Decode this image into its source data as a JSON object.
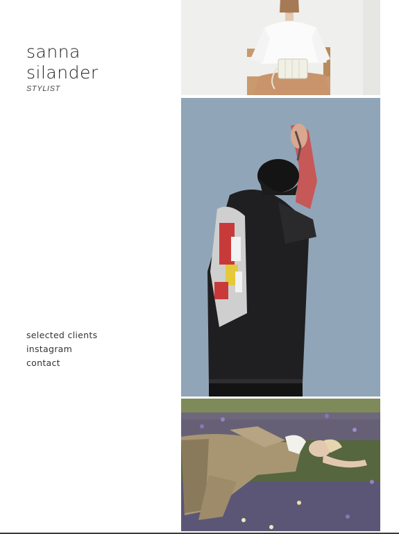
{
  "brand": {
    "first_name": "sanna",
    "last_name": "silander",
    "role": "STYLIST"
  },
  "nav": {
    "items": [
      {
        "label": "selected clients"
      },
      {
        "label": "instagram"
      },
      {
        "label": "contact"
      }
    ]
  },
  "gallery": {
    "photos": [
      {
        "subject": "woman in white shirt seated with handbag"
      },
      {
        "subject": "person in painted leather coat against blue wall"
      },
      {
        "subject": "person in trench coat lying in flower field"
      }
    ]
  },
  "colors": {
    "text": "#1f1f1f",
    "nav_text": "#333333",
    "wall_blue": "#8ea3b6",
    "background": "#ffffff"
  }
}
